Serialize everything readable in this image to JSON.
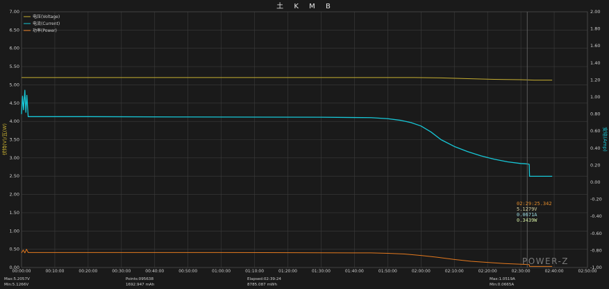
{
  "toolbar": {
    "items": [
      "土",
      "K",
      "M",
      "B"
    ]
  },
  "watermark": "POWER-Z",
  "colors": {
    "voltage": "#c8b032",
    "current": "#17c8d8",
    "power": "#e67a1e",
    "grid": "#3c3c3c",
    "background": "#1a1a1a",
    "cursor_time": "#e08a2a",
    "cursor_values": "#d8d2a0",
    "cursor_current": "#9ad9e0",
    "cursor_power": "#cfe8a0"
  },
  "chart_data": {
    "type": "line",
    "xlabel": "",
    "ylabel_left": "伏特(V)/瓦(W)",
    "ylabel_right": "安培(Amp)",
    "x_ticks": [
      "00:00:00",
      "00:10:00",
      "00:20:00",
      "00:30:00",
      "00:40:00",
      "00:50:00",
      "01:00:00",
      "01:10:00",
      "01:20:00",
      "01:30:00",
      "01:40:00",
      "01:50:00",
      "02:00:00",
      "02:10:00",
      "02:20:00",
      "02:30:00",
      "02:40:00",
      "02:50:00"
    ],
    "xlim_minutes": [
      0,
      170
    ],
    "ylim_left": [
      0,
      7
    ],
    "ylim_right": [
      -1,
      2
    ],
    "y_ticks_left": [
      "0.00",
      "0.50",
      "1.00",
      "1.50",
      "2.00",
      "2.50",
      "3.00",
      "3.50",
      "4.00",
      "4.50",
      "5.00",
      "5.50",
      "6.00",
      "6.50",
      "7.00"
    ],
    "y_ticks_right": [
      "-1.00",
      "-0.80",
      "-0.60",
      "-0.40",
      "-0.20",
      "0.00",
      "0.20",
      "0.40",
      "0.60",
      "0.80",
      "1.00",
      "1.20",
      "1.40",
      "1.60",
      "1.80",
      "2.00"
    ],
    "legend_position": "top-left",
    "grid": true,
    "series": [
      {
        "name": "电压(Voltage)",
        "axis": "left",
        "color_key": "voltage",
        "x": [
          0,
          60,
          110,
          118,
          126,
          134,
          142,
          150,
          154,
          159.4
        ],
        "y": [
          5.2,
          5.2,
          5.2,
          5.2,
          5.19,
          5.17,
          5.15,
          5.14,
          5.13,
          5.13
        ]
      },
      {
        "name": "电流(Current)",
        "axis": "right",
        "color_key": "current",
        "x": [
          0,
          0.3,
          0.6,
          1.0,
          1.3,
          1.6,
          2,
          20,
          50,
          90,
          105,
          110,
          114,
          117,
          120,
          123,
          126,
          130,
          134,
          138,
          142,
          146,
          150,
          152,
          152.5,
          152.6,
          159.4
        ],
        "y": [
          0.8,
          1.01,
          0.85,
          1.08,
          0.82,
          1.02,
          0.77,
          0.77,
          0.766,
          0.763,
          0.758,
          0.746,
          0.726,
          0.7,
          0.66,
          0.59,
          0.5,
          0.42,
          0.36,
          0.31,
          0.27,
          0.24,
          0.22,
          0.215,
          0.21,
          0.07,
          0.07
        ]
      },
      {
        "name": "功率(Power)",
        "axis": "left",
        "color_key": "power",
        "x": [
          0,
          0.5,
          1.0,
          1.5,
          2,
          60,
          105,
          110,
          115,
          120,
          125,
          130,
          135,
          140,
          145,
          150,
          152.5,
          152.6,
          159.4
        ],
        "y": [
          0.4,
          0.48,
          0.4,
          0.5,
          0.41,
          0.41,
          0.4,
          0.39,
          0.37,
          0.33,
          0.28,
          0.22,
          0.17,
          0.14,
          0.11,
          0.09,
          0.08,
          0.03,
          0.03
        ]
      }
    ],
    "cursor": {
      "x": 151.9,
      "time": "02:29:25.342",
      "voltage": "5.1279V",
      "current": "0.0671A",
      "power": "0.3439W"
    },
    "stats": {
      "max_voltage": "Max:5.2057V",
      "min_voltage": "Min:5.1266V",
      "points": "Points:095638",
      "capacity": "1692.947 mAh",
      "elapsed": "Elapsed:02:39:24",
      "energy": "8785.087 mWh",
      "max_current": "Max:1.0519A",
      "min_current": "Min:0.0665A"
    }
  }
}
